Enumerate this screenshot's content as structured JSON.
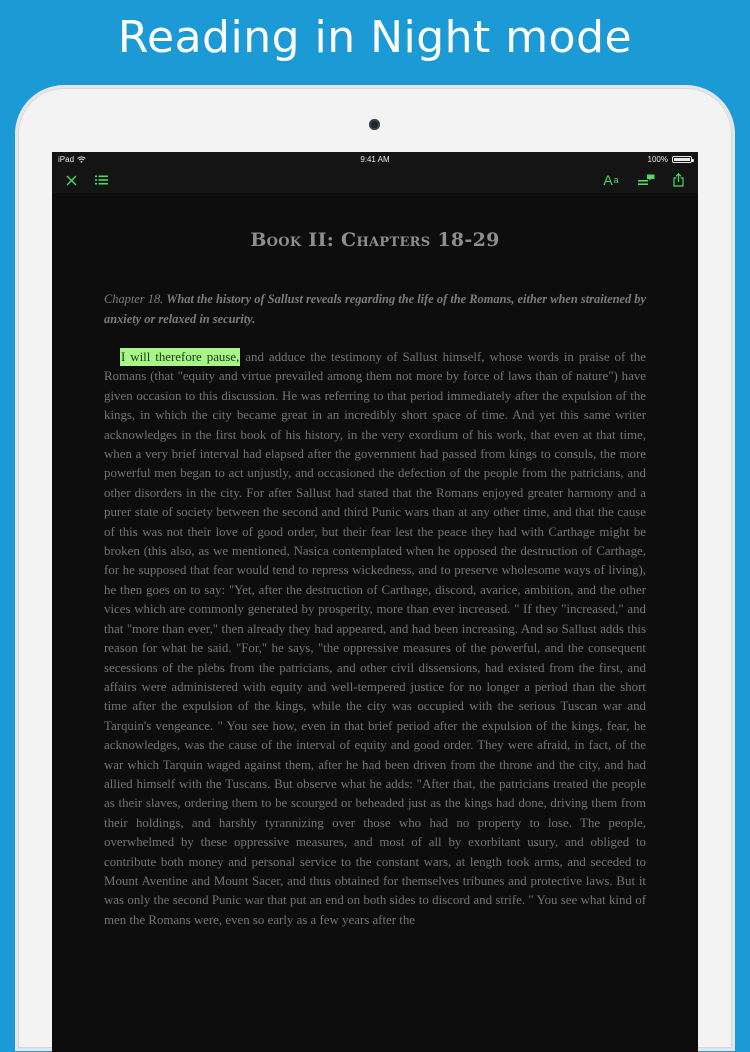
{
  "promo": {
    "headline": "Reading in Night mode"
  },
  "status_bar": {
    "device": "iPad",
    "time": "9:41 AM",
    "battery": "100%"
  },
  "toolbar": {
    "font_label_big": "A",
    "font_label_small": "a",
    "icons": [
      "close-icon",
      "table-of-contents-icon",
      "notes-icon",
      "share-icon"
    ],
    "accent_color": "#4cd964"
  },
  "book": {
    "title": "Book II: Chapters 18-29",
    "chapter_label": "Chapter 18.",
    "chapter_summary": "What the history of Sallust reveals regarding the life of the Romans, either when straitened by anxiety or relaxed in security.",
    "highlighted_text": "I will therefore pause,",
    "highlight_color": "#a8f58a",
    "body_text": "and adduce the testimony of Sallust himself, whose words in praise of the Romans (that \"equity and virtue prevailed among them not more by force of laws than of nature\") have given occasion to this discussion. He was referring to that period immediately after the expulsion of the kings, in which the city became great in an incredibly short space of time. And yet this same writer acknowledges in the first book of his history, in the very exordium of his work, that even at that time, when a very brief interval had elapsed after the government had passed from kings to consuls, the more powerful men began to act unjustly, and occasioned the defection of the people from the patricians, and other disorders in the city. For after Sallust had stated that the Romans enjoyed greater harmony and a purer state of society between the second and third Punic wars than at any other time, and that the cause of this was not their love of good order, but their fear lest the peace they had with Carthage might be broken (this also, as we mentioned, Nasica contemplated when he opposed the destruction of Carthage, for he supposed that fear would tend to repress wickedness, and to preserve wholesome ways of living), he then goes on to say: \"Yet, after the destruction of Carthage, discord, avarice, ambition, and the other vices which are commonly generated by prosperity, more than ever increased. \" If they \"increased,\" and that \"more than ever,\" then already they had appeared, and had been increasing. And so Sallust adds this reason for what he said. \"For,\" he says, \"the oppressive measures of the powerful, and the consequent secessions of the plebs from the patricians, and other civil dissensions, had existed from the first, and affairs were administered with equity and well-tempered justice for no longer a period than the short time after the expulsion of the kings, while the city was occupied with the serious Tuscan war and Tarquin's vengeance. \" You see how, even in that brief period after the expulsion of the kings, fear, he acknowledges, was the cause of the interval of equity and good order. They were afraid, in fact, of the war which Tarquin waged against them, after he had been driven from the throne and the city, and had allied himself with the Tuscans. But observe what he adds: \"After that, the patricians treated the people as their slaves, ordering them to be scourged or beheaded just as the kings had done, driving them from their holdings, and harshly tyrannizing over those who had no property to lose. The people, overwhelmed by these oppressive measures, and most of all by exorbitant usury, and obliged to contribute both money and personal service to the constant wars, at length took arms, and seceded to Mount Aventine and Mount Sacer, and thus obtained for themselves tribunes and protective laws. But it was only the second Punic war that put an end on both sides to discord and strife. \" You see what kind of men the Romans were, even so early as a few years after the"
  }
}
